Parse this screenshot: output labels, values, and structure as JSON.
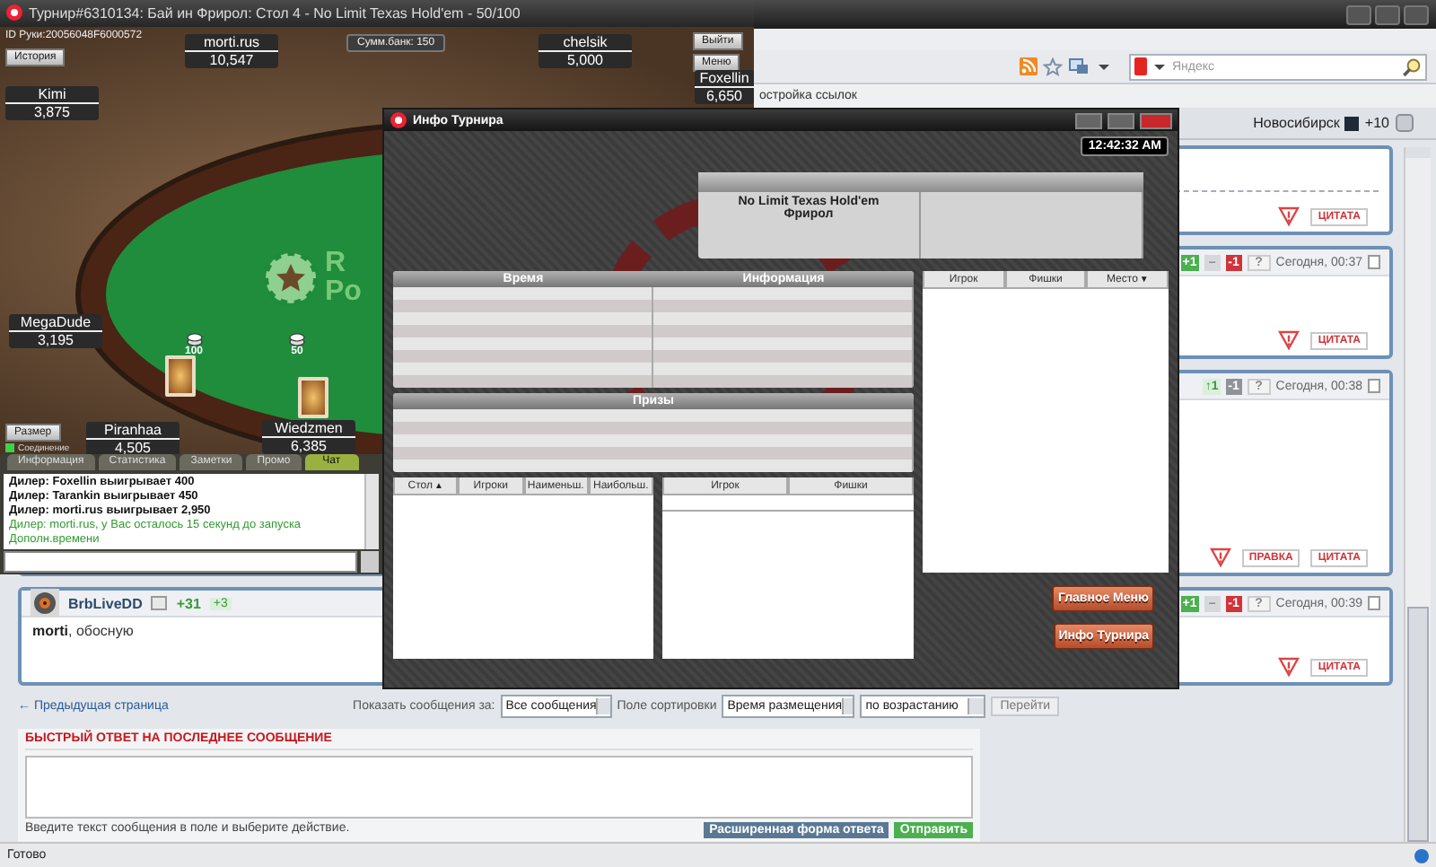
{
  "browser": {
    "search": {
      "placeholder": "Яндекс"
    },
    "links_bar": {
      "text": "остройка ссылок"
    },
    "weather": {
      "city": "Новосибирск",
      "temperature": "+10"
    },
    "posts": [
      {
        "actions": [
          {
            "label": "ЦИТАТА"
          }
        ]
      },
      {
        "votes": [
          {
            "label": "+1",
            "kind": "plus"
          },
          {
            "label": "–",
            "kind": "zero"
          },
          {
            "label": "-1",
            "kind": "minus"
          },
          {
            "label": "?",
            "kind": "help"
          }
        ],
        "time": "Сегодня, 00:37",
        "actions": [
          {
            "label": "ЦИТАТА"
          }
        ]
      },
      {
        "votes": [
          {
            "label": "↑1",
            "kind": "up"
          },
          {
            "label": "-1",
            "kind": "dim"
          },
          {
            "label": "?",
            "kind": "help"
          }
        ],
        "time": "Сегодня, 00:38",
        "actions": [
          {
            "label": "ПРАВКА"
          },
          {
            "label": "ЦИТАТА"
          }
        ]
      },
      {
        "author": "BrbLiveDD",
        "reputation": "+31",
        "reputation_delta": "+3",
        "votes": [
          {
            "label": "+1",
            "kind": "plus"
          },
          {
            "label": "–",
            "kind": "zero"
          },
          {
            "label": "-1",
            "kind": "minus"
          },
          {
            "label": "?",
            "kind": "help"
          }
        ],
        "time": "Сегодня, 00:39",
        "text": "**morti**, обосную",
        "actions": [
          {
            "label": "ЦИТАТА"
          }
        ]
      }
    ],
    "previous_page_link": "← Предыдущая страница",
    "sort": {
      "show_label": "Показать сообщения за:",
      "show_value": "Все сообщения",
      "sort_label": "Поле сортировки",
      "sort_value": "Время размещения",
      "order_value": "по возрастанию",
      "go_button": "Перейти"
    },
    "quick_reply": {
      "title": "БЫСТРЫЙ ОТВЕТ НА ПОСЛЕДНЕЕ СООБЩЕНИЕ",
      "hint": "Введите текст сообщения в поле и выберите действие.",
      "buttons": [
        {
          "label": "Расширенная форма ответа",
          "kind": "secondary"
        },
        {
          "label": "Отправить",
          "kind": "primary"
        }
      ]
    },
    "status_bar": "Готово"
  },
  "poker": {
    "title": "Турнир#6310134: Бай ин Фрирол: Стол 4 - No Limit Texas Hold'em - 50/100",
    "hand_id": "ID Руки:20056048F6000572",
    "history_button": "История",
    "exit_button": "Выйти",
    "menu_button": "Меню",
    "resize_button": "Размер",
    "pot": "Сумм.банк: 150",
    "table_logo": [
      "R",
      "Po"
    ],
    "players": [
      {
        "name": "morti.rus",
        "stack": "10,547",
        "cards": false
      },
      {
        "name": "chelsik",
        "stack": "5,000",
        "cards": false
      },
      {
        "name": "Foxellin",
        "stack": "6,650",
        "cards": false
      },
      {
        "name": "Kimi",
        "stack": "3,875",
        "cards": false
      },
      {
        "name": "MegaDude",
        "stack": "3,195",
        "cards": false
      },
      {
        "name": "Piranhaa",
        "stack": "4,505",
        "bet": "100",
        "cards": true
      },
      {
        "name": "Wiedzmen",
        "stack": "6,385",
        "bet": "50",
        "cards": true
      }
    ],
    "connection": {
      "label": "Соединение",
      "connected": true
    },
    "tabs": [
      {
        "label": "Информация",
        "selected": false
      },
      {
        "label": "Статистика",
        "selected": false
      },
      {
        "label": "Заметки",
        "selected": false
      },
      {
        "label": "Промо",
        "selected": false
      },
      {
        "label": "Чат",
        "selected": true
      }
    ],
    "chat": [
      {
        "text": "Дилер: Foxellin выигрывает 400",
        "kind": "dealer"
      },
      {
        "text": "Дилер: Tarankin выигрывает 450",
        "kind": "dealer"
      },
      {
        "text": "Дилер: morti.rus выигрывает 2,950",
        "kind": "dealer"
      },
      {
        "text": "Дилер: morti.rus, у Вас осталось 15 секунд до запуска",
        "kind": "system"
      },
      {
        "text": "Дополн.времени",
        "kind": "system"
      }
    ]
  },
  "tournament": {
    "title": "Инфо Турнира",
    "clock": "12:42:32 AM",
    "info": {
      "lines": [
        "No Limit Texas Hold'em",
        "Фрирол"
      ]
    },
    "schedule": {
      "columns": [
        "Время",
        "Информация"
      ]
    },
    "prizes": {
      "title": "Призы"
    },
    "tables": {
      "columns": [
        {
          "label": "Стол",
          "sort_icon": "▲"
        },
        {
          "label": "Игроки"
        },
        {
          "label": "Наименьш."
        },
        {
          "label": "Наибольш."
        }
      ]
    },
    "table_players": {
      "columns": [
        {
          "label": "Игрок"
        },
        {
          "label": "Фишки"
        }
      ]
    },
    "players": {
      "columns": [
        {
          "label": "Игрок"
        },
        {
          "label": "Фишки"
        },
        {
          "label": "Место",
          "sort_icon": "▼"
        }
      ]
    },
    "buttons": [
      "Главное Меню",
      "Инфо Турнира"
    ]
  }
}
